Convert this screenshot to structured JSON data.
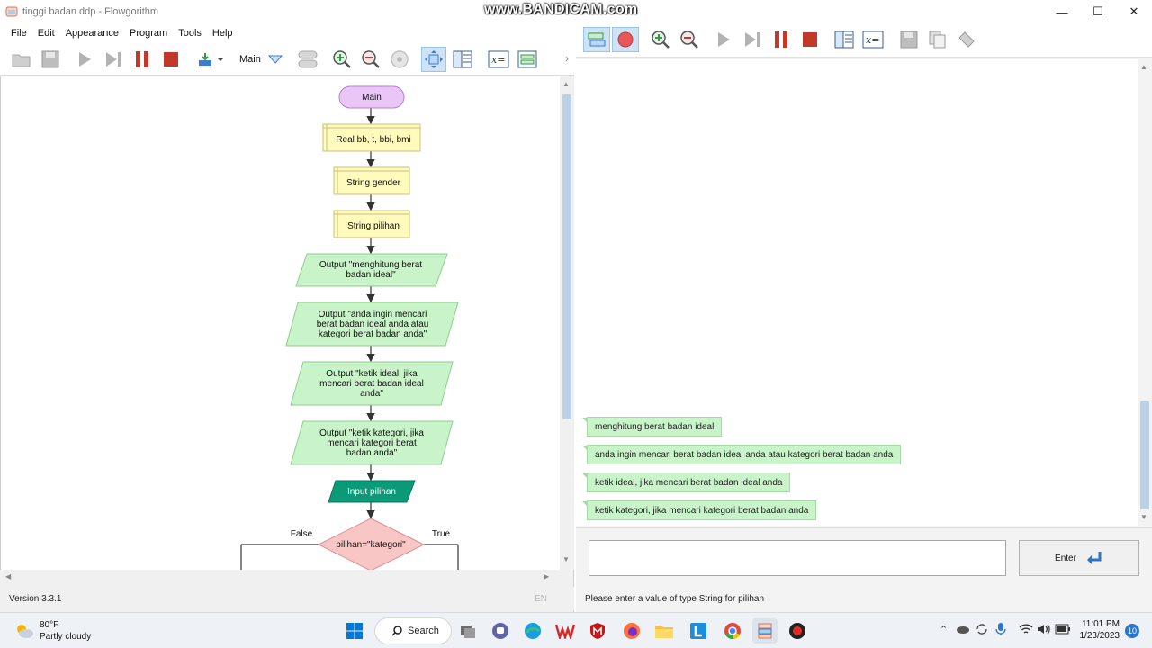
{
  "watermark": "www.BANDICAM.com",
  "left_window": {
    "title": "tinggi badan ddp - Flowgorithm",
    "menu": [
      "File",
      "Edit",
      "Appearance",
      "Program",
      "Tools",
      "Help"
    ],
    "function_selector": "Main",
    "version": "Version 3.3.1",
    "lang": "EN"
  },
  "flowchart": {
    "start": "Main",
    "declares": [
      "Real bb, t, bbi, bmi",
      "String gender",
      "String pilihan"
    ],
    "outputs": [
      "Output \"menghitung berat badan ideal\"",
      "Output \"anda ingin mencari berat badan ideal anda atau kategori berat badan anda\"",
      "Output \"ketik ideal, jika mencari berat badan ideal anda\"",
      "Output \"ketik kategori, jika mencari kategori berat badan anda\""
    ],
    "input": "Input pilihan",
    "decision": "pilihan=\"kategori\"",
    "false_label": "False",
    "true_label": "True"
  },
  "console": {
    "messages": [
      "menghitung berat badan ideal",
      "anda ingin mencari berat badan ideal anda atau kategori berat badan anda",
      "ketik ideal, jika mencari berat badan ideal anda",
      "ketik kategori, jika mencari kategori berat badan anda"
    ],
    "input_value": "",
    "enter_label": "Enter",
    "status": "Please enter a value of type String for pilihan"
  },
  "window_controls": {
    "minimize": "—",
    "maximize": "☐",
    "close": "✕"
  },
  "taskbar": {
    "weather_temp": "80°F",
    "weather_desc": "Partly cloudy",
    "search_label": "Search",
    "time": "11:01 PM",
    "date": "1/23/2023",
    "notifications": "10"
  },
  "colors": {
    "start_fill": "#e9c6f5",
    "declare_fill": "#fffbbd",
    "output_fill": "#c9f3c9",
    "input_fill": "#0a9a77",
    "decision_fill": "#f9c6c6",
    "bubble_fill": "#c9f3c9"
  }
}
